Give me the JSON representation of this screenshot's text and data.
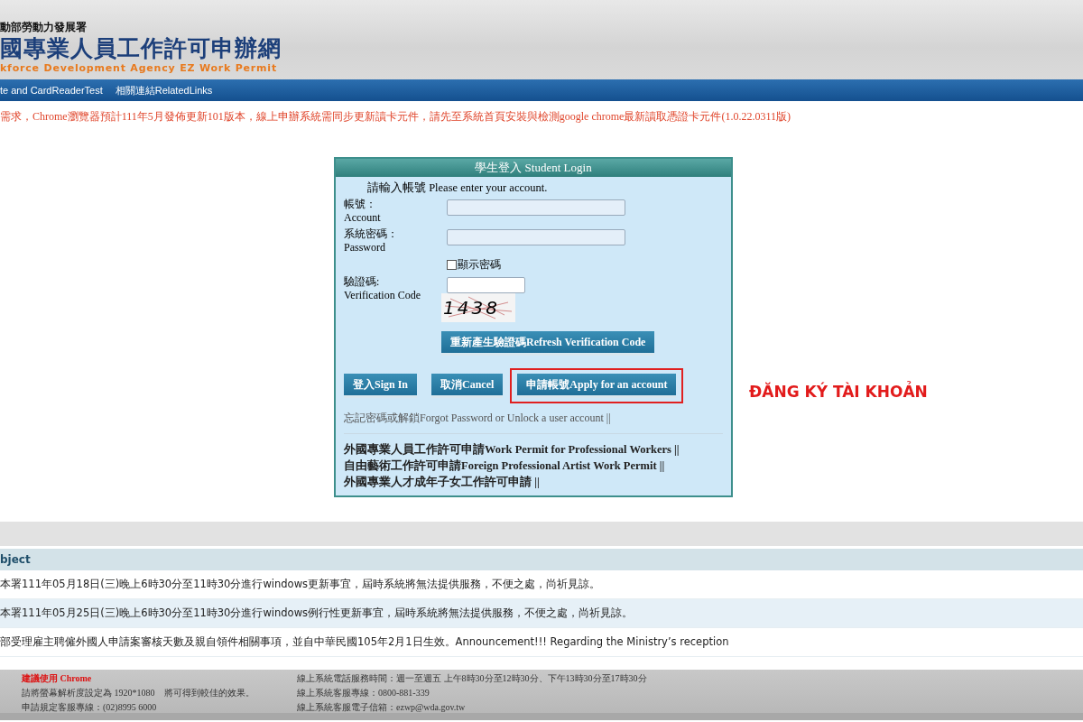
{
  "header": {
    "agency": "動部勞動力發展署",
    "site_title": "國專業人員工作許可申辦網",
    "subtitle": "kforce Development Agency EZ Work Permit"
  },
  "nav": [
    {
      "label": "te and CardReaderTest"
    },
    {
      "label": "相關連結RelatedLinks"
    }
  ],
  "notice": "需求，Chrome瀏覽器預計111年5月發佈更新101版本，線上申辦系統需同步更新讀卡元件，請先至系統首頁安裝與檢測google chrome最新讀取憑證卡元件(1.0.22.0311版)",
  "login": {
    "title": "學生登入 Student Login",
    "prompt": "請輸入帳號 Please enter your account.",
    "fields": [
      {
        "label": "帳號：",
        "label_en": "Account"
      },
      {
        "label": "系統密碼：",
        "label_en": "Password"
      }
    ],
    "show_password": {
      "label": "顯示密碼",
      "checked": false
    },
    "captcha": {
      "label": "驗證碼:",
      "label_en": "Verification Code",
      "image_text": "1438"
    },
    "refresh_button": "重新產生驗證碼Refresh Verification Code",
    "buttons": [
      {
        "label": "登入Sign In",
        "highlighted": false
      },
      {
        "label": "取消Cancel",
        "highlighted": false
      },
      {
        "label": "申請帳號Apply for an account",
        "highlighted": true
      }
    ],
    "forgot_link": "忘記密碼或解鎖Forgot Password or Unlock a user account ||",
    "links": [
      {
        "label": "外國專業人員工作許可申請Work Permit for Professional Workers ||"
      },
      {
        "label": "自由藝術工作許可申請Foreign Professional Artist Work Permit ||"
      },
      {
        "label": "外國專業人才成年子女工作許可申請 ||"
      }
    ]
  },
  "annotation": "ĐĂNG KÝ TÀI KHOẢN",
  "announcements": {
    "column": "bject",
    "rows": [
      {
        "text": "本署111年05月18日(三)晚上6時30分至11時30分進行windows更新事宜，屆時系統將無法提供服務，不便之處，尚祈見諒。"
      },
      {
        "text": "本署111年05月25日(三)晚上6時30分至11時30分進行windows例行性更新事宜，屆時系統將無法提供服務，不便之處，尚祈見諒。"
      },
      {
        "text": "部受理雇主聘僱外國人申請案審核天數及親自領件相關事項，並自中華民國105年2月1日生效。Announcement!!! Regarding the Ministry’s reception"
      }
    ]
  },
  "footer": {
    "browser_note": "建議使用 Chrome",
    "left": [
      "請將螢幕解析度設定為 1920*1080　將可得到較佳的效果。",
      "申請規定客服專線：(02)8995 6000"
    ],
    "right": [
      "線上系統電話服務時間：週一至週五 上午8時30分至12時30分、下午13時30分至17時30分",
      "線上系統客服專線：0800-881-339",
      "線上系統客服電子信箱：ezwp@wda.gov.tw"
    ]
  }
}
